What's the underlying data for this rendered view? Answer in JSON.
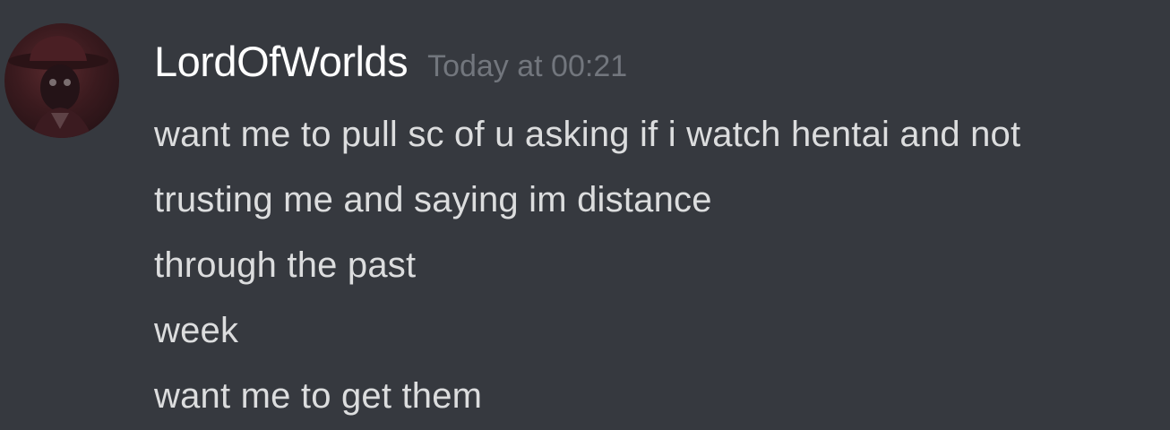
{
  "message": {
    "author": "LordOfWorlds",
    "timestamp": "Today at 00:21",
    "avatar_icon": "user-avatar-hat-icon",
    "lines": [
      "want me to pull sc of u asking if i watch hentai and not",
      "trusting me and saying im distance",
      "through the past",
      "week",
      "want me to get them"
    ]
  },
  "colors": {
    "background": "#36393f",
    "username": "#ffffff",
    "timestamp": "#72767d",
    "text": "#dcddde"
  }
}
